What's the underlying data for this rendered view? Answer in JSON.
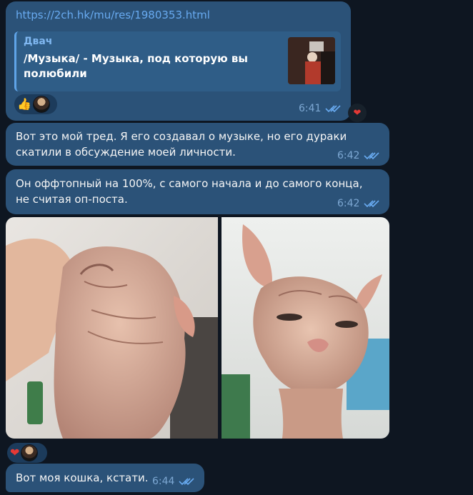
{
  "messages": [
    {
      "link": "https://2ch.hk/mu/res/1980353.html",
      "preview": {
        "site": "Двач",
        "title": "/Музыка/ - Музыка, под которую вы полюбили"
      },
      "reactions": [
        "thumbs-up",
        "avatar"
      ],
      "time": "6:41",
      "badge": "heart"
    },
    {
      "text": "Вот это мой тред. Я его создавал о музыке, но его дураки скатили в обсуждение моей личности.",
      "time": "6:42"
    },
    {
      "text": "Он оффтопный на 100%, с самого начала и до самого конца, не считая оп-поста.",
      "time": "6:42"
    },
    {
      "photos": [
        "sphynx-cat-photo-1",
        "sphynx-cat-photo-2"
      ],
      "reactions": [
        "heart",
        "avatar"
      ]
    },
    {
      "text": "Вот моя кошка, кстати.",
      "time": "6:44"
    }
  ],
  "colors": {
    "bubble": "#2b5278",
    "background": "#0e1621",
    "link": "#68aaf0",
    "meta": "#7da8d3"
  },
  "emoji": {
    "thumbs_up": "👍",
    "heart": "❤"
  }
}
